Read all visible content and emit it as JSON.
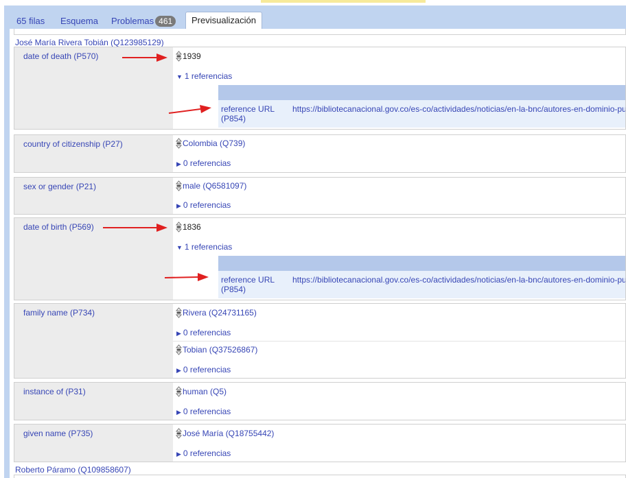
{
  "tabs": {
    "rows": "65 filas",
    "schema": "Esquema",
    "problems": "Problemas",
    "problems_count": "461",
    "preview": "Previsualización"
  },
  "entities": [
    {
      "title": "José María Rivera Tobián (Q123985129)",
      "statements": [
        {
          "property": "date of death (P570)",
          "values": [
            {
              "text": "1939",
              "plain": true,
              "refs": "1 referencias",
              "expanded": true,
              "reference": {
                "property": "reference URL (P854)",
                "url": "https://bibliotecanacional.gov.co/es-co/actividades/noticias/en-la-bnc/autores-en-dominio-publ"
              }
            }
          ]
        },
        {
          "property": "country of citizenship (P27)",
          "values": [
            {
              "text": "Colombia (Q739)",
              "refs": "0 referencias"
            }
          ]
        },
        {
          "property": "sex or gender (P21)",
          "values": [
            {
              "text": "male (Q6581097)",
              "refs": "0 referencias"
            }
          ]
        },
        {
          "property": "date of birth (P569)",
          "values": [
            {
              "text": "1836",
              "plain": true,
              "refs": "1 referencias",
              "expanded": true,
              "reference": {
                "property": "reference URL (P854)",
                "url": "https://bibliotecanacional.gov.co/es-co/actividades/noticias/en-la-bnc/autores-en-dominio-publ"
              }
            }
          ]
        },
        {
          "property": "family name (P734)",
          "values": [
            {
              "text": "Rivera (Q24731165)",
              "refs": "0 referencias"
            },
            {
              "text": "Tobian (Q37526867)",
              "refs": "0 referencias"
            }
          ]
        },
        {
          "property": "instance of (P31)",
          "values": [
            {
              "text": "human (Q5)",
              "refs": "0 referencias"
            }
          ]
        },
        {
          "property": "given name (P735)",
          "values": [
            {
              "text": "José María (Q18755442)",
              "refs": "0 referencias"
            }
          ]
        }
      ]
    },
    {
      "title": "Roberto Páramo (Q109858607)",
      "statements": []
    }
  ],
  "colors": {
    "link": "#3645b5",
    "frame": "#c0d4f0",
    "property_cell": "#ececec",
    "reference_header": "#b4c8ea",
    "reference_row": "#e8f0fb",
    "annotation_arrow": "#e02020"
  }
}
